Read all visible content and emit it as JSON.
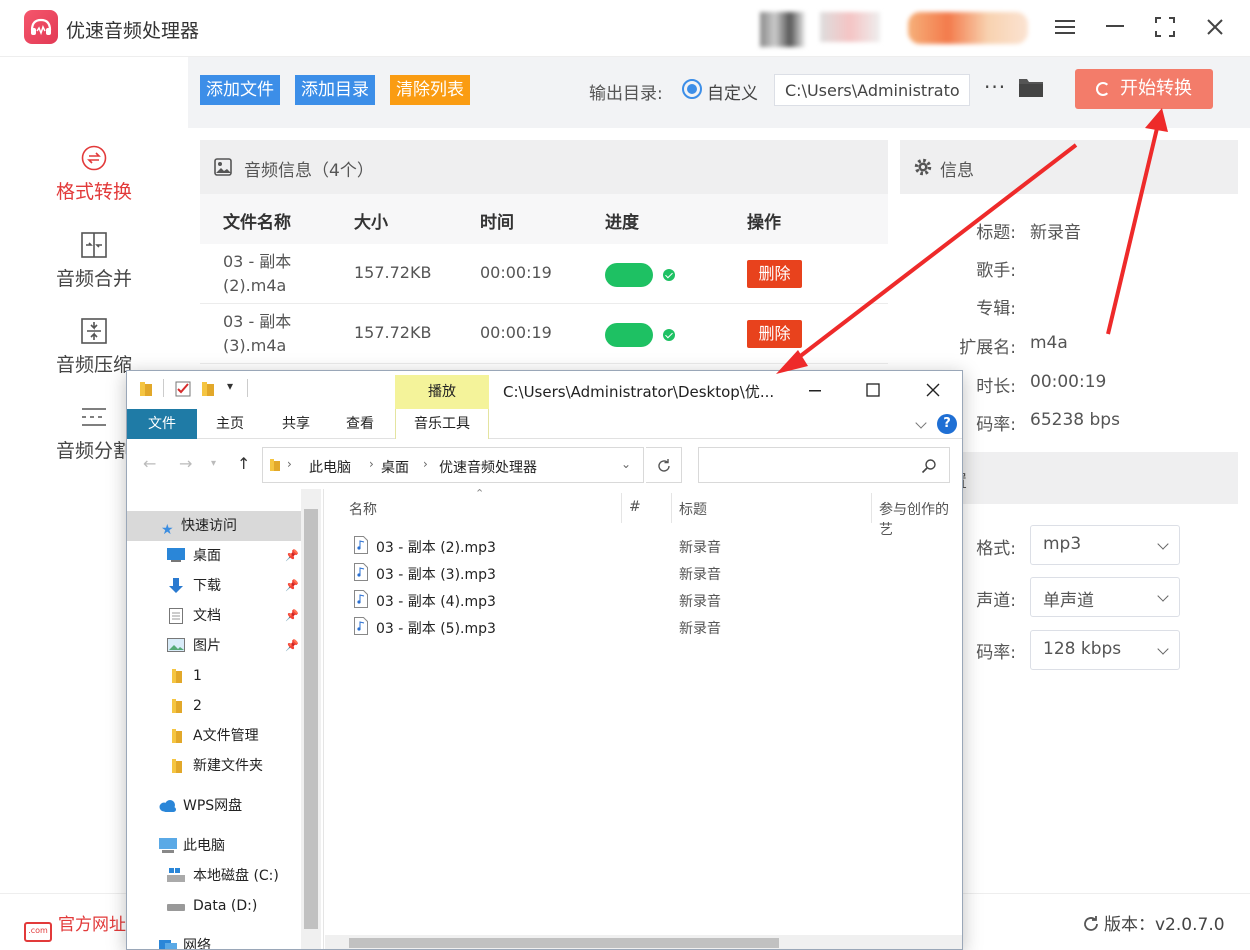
{
  "app": {
    "title": "优速音频处理器"
  },
  "sidebar": {
    "items": [
      {
        "label": "格式转换",
        "icon": "swap-icon"
      },
      {
        "label": "音频合并",
        "icon": "merge-icon"
      },
      {
        "label": "音频压缩",
        "icon": "compress-icon"
      },
      {
        "label": "音频分割",
        "icon": "split-icon"
      }
    ]
  },
  "toolbar": {
    "add_file": "添加文件",
    "add_folder": "添加目录",
    "clear_list": "清除列表",
    "output_label": "输出目录:",
    "radio_label": "自定义",
    "output_path": "C:\\Users\\Administrator\\",
    "more": "···",
    "start": "开始转换"
  },
  "audio_panel": {
    "title": "音频信息（4个）",
    "columns": [
      "文件名称",
      "大小",
      "时间",
      "进度",
      "操作"
    ],
    "rows": [
      {
        "name": "03 - 副本 (2).m4a",
        "size": "157.72KB",
        "time": "00:00:19",
        "progress": 1.0,
        "action": "删除"
      },
      {
        "name": "03 - 副本 (3).m4a",
        "size": "157.72KB",
        "time": "00:00:19",
        "progress": 1.0,
        "action": "删除"
      }
    ]
  },
  "info_panel": {
    "title": "信息",
    "fields": [
      {
        "label": "标题:",
        "value": "新录音"
      },
      {
        "label": "歌手:",
        "value": ""
      },
      {
        "label": "专辑:",
        "value": ""
      },
      {
        "label": "扩展名:",
        "value": "m4a"
      },
      {
        "label": "时长:",
        "value": "00:00:19"
      },
      {
        "label": "码率:",
        "value": "65238 bps"
      }
    ]
  },
  "settings_panel": {
    "title": "置",
    "fields": [
      {
        "label": "格式:",
        "value": "mp3"
      },
      {
        "label": "声道:",
        "value": "单声道"
      },
      {
        "label": "码率:",
        "value": "128 kbps"
      }
    ]
  },
  "footer": {
    "official": "官方网址",
    "official_icon_text": ".com",
    "version": "版本：v2.0.7.0"
  },
  "explorer": {
    "title_path": "C:\\Users\\Administrator\\Desktop\\优...",
    "context_tab": "播放",
    "ribbon_tabs": [
      "文件",
      "主页",
      "共享",
      "查看",
      "音乐工具"
    ],
    "help": "?",
    "breadcrumb": [
      "此电脑",
      "桌面",
      "优速音频处理器"
    ],
    "nav_items": [
      {
        "label": "快速访问",
        "icon": "star-icon",
        "pinned": false
      },
      {
        "label": "桌面",
        "icon": "desktop-icon",
        "pinned": true
      },
      {
        "label": "下载",
        "icon": "download-icon",
        "pinned": true
      },
      {
        "label": "文档",
        "icon": "document-icon",
        "pinned": true
      },
      {
        "label": "图片",
        "icon": "picture-icon",
        "pinned": true
      },
      {
        "label": "1",
        "icon": "folder-icon",
        "pinned": false
      },
      {
        "label": "2",
        "icon": "folder-icon",
        "pinned": false
      },
      {
        "label": "A文件管理",
        "icon": "folder-icon",
        "pinned": false
      },
      {
        "label": "新建文件夹",
        "icon": "folder-icon",
        "pinned": false
      },
      {
        "label": "WPS网盘",
        "icon": "cloud-icon",
        "pinned": false
      },
      {
        "label": "此电脑",
        "icon": "computer-icon",
        "pinned": false
      },
      {
        "label": "本地磁盘 (C:)",
        "icon": "drive-icon",
        "pinned": false
      },
      {
        "label": "Data (D:)",
        "icon": "drive-icon",
        "pinned": false
      },
      {
        "label": "网络",
        "icon": "network-icon",
        "pinned": false
      }
    ],
    "columns": [
      "名称",
      "#",
      "标题",
      "参与创作的艺"
    ],
    "files": [
      {
        "name": "03 - 副本 (2).mp3",
        "title": "新录音"
      },
      {
        "name": "03 - 副本 (3).mp3",
        "title": "新录音"
      },
      {
        "name": "03 - 副本 (4).mp3",
        "title": "新录音"
      },
      {
        "name": "03 - 副本 (5).mp3",
        "title": "新录音"
      }
    ]
  },
  "colors": {
    "accent_red": "#e23a3a",
    "btn_blue": "#3c8ee8",
    "btn_orange": "#fa9c12",
    "start_btn": "#f37c6a",
    "progress_green": "#1ec163",
    "delete_red": "#e8421d",
    "arrow_red": "#ee2a2a"
  }
}
